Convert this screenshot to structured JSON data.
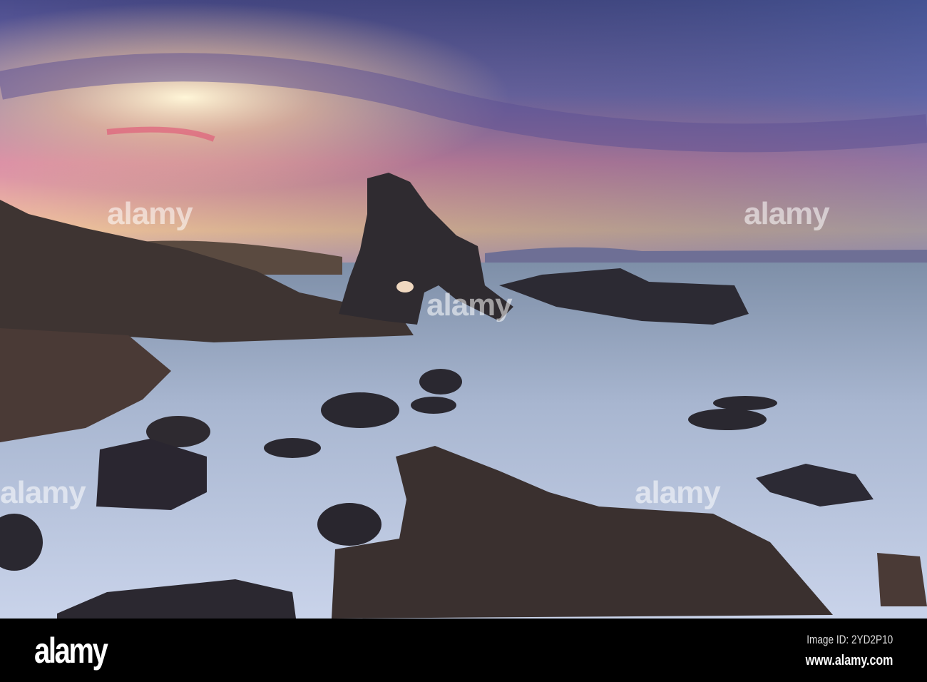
{
  "photo": {
    "subject": "Sea stack arch at sunset with long-exposure surf over rocks",
    "watermark_text": "alamy"
  },
  "footer": {
    "logo": "alamy",
    "image_id": "Image ID: 2YD2P10",
    "url": "www.alamy.com"
  }
}
